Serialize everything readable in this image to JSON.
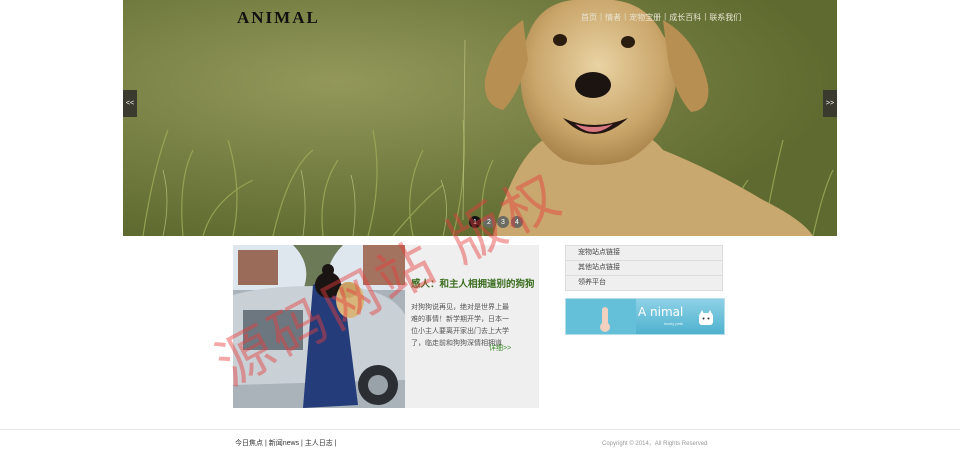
{
  "header": {
    "logo": "ANIMAL",
    "nav": [
      "首页",
      "情者",
      "宠物宝册",
      "成长百科",
      "联系我们"
    ],
    "prev_label": "<<",
    "next_label": ">>",
    "slides": [
      "1",
      "2",
      "3",
      "4"
    ],
    "active_slide": 1
  },
  "feature": {
    "title": "感人：和主人相拥道别的狗狗",
    "body": "对狗狗说再见，绝对是世界上最难的事情！新学期开学，日本一位小主人要离开家出门去上大学了，临走前和狗狗深情相拥道",
    "more": "详细>>"
  },
  "sidebar": {
    "links": [
      "宠物站点链接",
      "其他站点链接",
      "领养平台"
    ],
    "promo_title": "A nimal",
    "promo_sub": "lovely pets"
  },
  "footer": {
    "links": [
      "今日焦点",
      "新闻news",
      "主人日志"
    ],
    "separator": "|",
    "copyright": "Copyright © 2014，All Rights Reserved"
  },
  "watermark": "源码网站 版权",
  "colors": {
    "feature_title": "#3b6d1f",
    "more_link": "#3b8d2a",
    "watermark": "#e63c3c"
  }
}
